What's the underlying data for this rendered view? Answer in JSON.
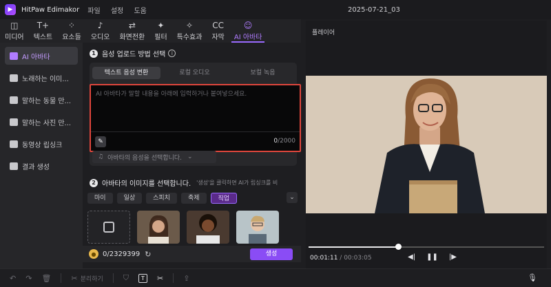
{
  "app": {
    "name": "HitPaw Edimakor",
    "menu": [
      "파일",
      "설정",
      "도움"
    ],
    "doc_title": "2025-07-21_03"
  },
  "toolbar": [
    {
      "icon": "media-icon",
      "glyph": "◫",
      "label": "미디어"
    },
    {
      "icon": "text-icon",
      "glyph": "T+",
      "label": "텍스트"
    },
    {
      "icon": "elements-icon",
      "glyph": "⁘",
      "label": "요소들"
    },
    {
      "icon": "audio-icon",
      "glyph": "♪",
      "label": "오디오"
    },
    {
      "icon": "transition-icon",
      "glyph": "⇄",
      "label": "화면전환"
    },
    {
      "icon": "filter-icon",
      "glyph": "✦",
      "label": "필터"
    },
    {
      "icon": "effects-icon",
      "glyph": "✧",
      "label": "특수효과"
    },
    {
      "icon": "subtitle-icon",
      "glyph": "CC",
      "label": "자막"
    },
    {
      "icon": "ai-avatar-icon",
      "glyph": "☺",
      "label": "AI 아바타"
    }
  ],
  "sidebar": [
    {
      "label": "AI 아바타",
      "icon": "user-icon",
      "active": true
    },
    {
      "label": "노래하는 이미...",
      "icon": "image-icon"
    },
    {
      "label": "말하는 동물 만...",
      "icon": "animal-icon"
    },
    {
      "label": "말하는 사진 만...",
      "icon": "photo-icon"
    },
    {
      "label": "동영상 립싱크",
      "icon": "video-icon"
    },
    {
      "label": "결과 생성",
      "icon": "folder-icon"
    }
  ],
  "step1": {
    "num": "1",
    "title": "음성 업로드 방법 선택"
  },
  "voice_tabs": [
    "텍스트 음성 변환",
    "로컬 오디오",
    "보컬 녹음"
  ],
  "textarea": {
    "placeholder": "AI 아바타가 말할 내용을 아래에 입력하거나 붙여넣으세요.",
    "count": "0",
    "max": "/2000"
  },
  "voice_select": {
    "placeholder": "아바타의 음성을 선택합니다."
  },
  "step2": {
    "num": "2",
    "title": "아바타의 이미지를 선택합니다.",
    "note": "'생성'을 클릭하면 AI가 립싱크를 비"
  },
  "categories": [
    "마이",
    "일상",
    "스피치",
    "축제",
    "직업"
  ],
  "active_category": "직업",
  "credit": "0/2329399",
  "generate_label": "생성",
  "player": {
    "title": "플레이어",
    "time_current": "00:01:11",
    "time_total": "/ 00:03:05",
    "progress": 0.38
  },
  "footer": {
    "split_label": "분리하기"
  }
}
